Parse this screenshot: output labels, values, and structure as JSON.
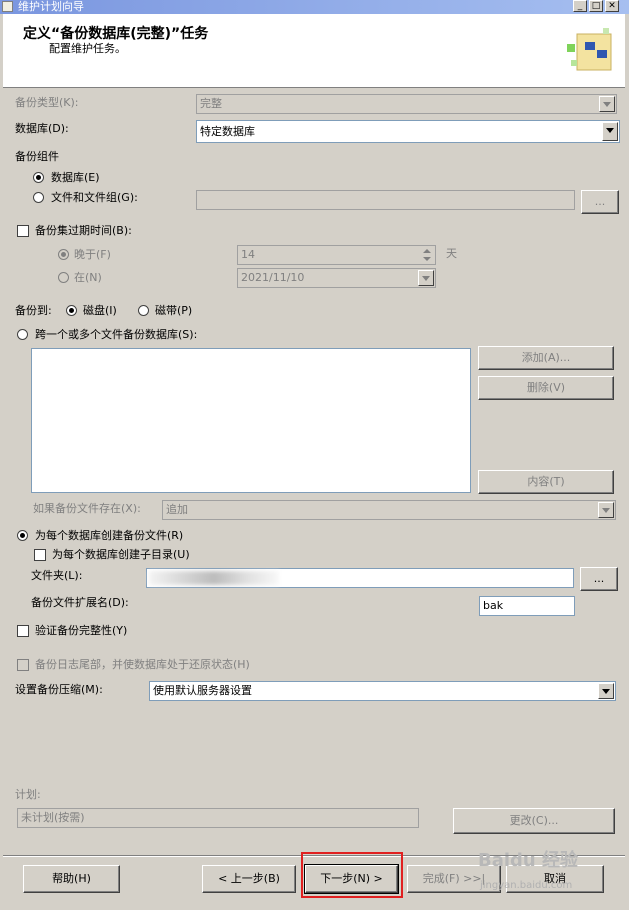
{
  "window": {
    "title": "维护计划向导"
  },
  "header": {
    "title": "定义“备份数据库(完整)”任务",
    "subtitle": "配置维护任务。"
  },
  "backup_type": {
    "label": "备份类型(K):",
    "value": "完整"
  },
  "database": {
    "label": "数据库(D):",
    "value": "特定数据库"
  },
  "backup_component": {
    "label": "备份组件",
    "option_database": "数据库(E)",
    "option_filegroup": "文件和文件组(G):",
    "filegroup_browse": "..."
  },
  "expire": {
    "label": "备份集过期时间(B):",
    "after_label": "晚于(F)",
    "after_value": "14",
    "after_unit": "天",
    "on_label": "在(N)",
    "on_value": "2021/11/10"
  },
  "backup_to": {
    "label": "备份到:",
    "disk": "磁盘(I)",
    "tape": "磁带(P)"
  },
  "span_files": {
    "label": "跨一个或多个文件备份数据库(S):",
    "add": "添加(A)...",
    "remove": "删除(V)",
    "contents": "内容(T)"
  },
  "if_exists": {
    "label": "如果备份文件存在(X):",
    "value": "追加"
  },
  "per_db": {
    "label": "为每个数据库创建备份文件(R)",
    "subdir_label": "为每个数据库创建子目录(U)",
    "folder_label": "文件夹(L):",
    "folder_browse": "...",
    "ext_label": "备份文件扩展名(D):",
    "ext_value": "bak"
  },
  "verify": {
    "label": "验证备份完整性(Y)"
  },
  "tail_log": {
    "label": "备份日志尾部，并使数据库处于还原状态(H)"
  },
  "compression": {
    "label": "设置备份压缩(M):",
    "value": "使用默认服务器设置"
  },
  "schedule": {
    "label": "计划:",
    "value": "未计划(按需)",
    "change": "更改(C)..."
  },
  "footer": {
    "help": "帮助(H)",
    "back": "< 上一步(B)",
    "next": "下一步(N) >",
    "finish": "完成(F) >>|",
    "cancel": "取消"
  },
  "watermark": {
    "text": "Baidu 经验",
    "sub": "jingyan.baidu.com"
  }
}
